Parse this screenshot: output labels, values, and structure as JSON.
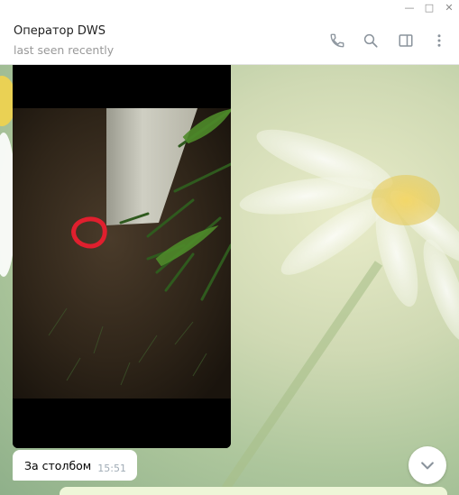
{
  "window": {
    "minimize_glyph": "—",
    "maximize_glyph": "□",
    "close_glyph": "✕"
  },
  "header": {
    "title": "Оператор DWS",
    "status": "last seen recently",
    "icons": [
      "phone-icon",
      "search-icon",
      "sidebar-toggle-icon",
      "more-icon"
    ],
    "icon_color": "#8a939c"
  },
  "messages": [
    {
      "type": "photo",
      "content": "photo: concrete post on dirt ground at night, red circle marked near its base"
    },
    {
      "type": "text",
      "text": "За столбом",
      "time": "15:51"
    }
  ],
  "colors": {
    "accent_mark": "#e01f2e",
    "bubble_in": "#ffffff",
    "bubble_out": "#eef6d8"
  }
}
